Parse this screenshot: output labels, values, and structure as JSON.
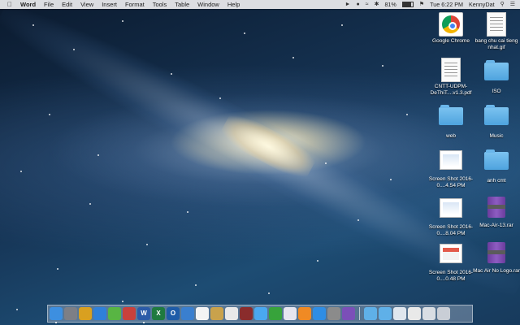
{
  "menubar": {
    "app_name": "Word",
    "menus": [
      "File",
      "Edit",
      "View",
      "Insert",
      "Format",
      "Tools",
      "Table",
      "Window",
      "Help"
    ],
    "battery_percent": "81%",
    "clock": "Tue 6:22 PM",
    "user": "KennyDat"
  },
  "desktop_icons": [
    {
      "label": "Google Chrome"
    },
    {
      "label": "bang chu cai tieng nhat.gif"
    },
    {
      "label": "CNTT-UDPM-DeThiT....v1.3.pdf"
    },
    {
      "label": "ISO"
    },
    {
      "label": "web"
    },
    {
      "label": "Music"
    },
    {
      "label": "Screen Shot 2016-0....4.54 PM"
    },
    {
      "label": "anh cmt"
    },
    {
      "label": "Screen Shot 2016-0....8.04 PM"
    },
    {
      "label": "Mac-Air-13.rar"
    },
    {
      "label": "Screen Shot 2016-0....0.48 PM"
    },
    {
      "label": "Mac Air No Logo.rar"
    }
  ],
  "dock": {
    "apps": [
      {
        "name": "finder-icon",
        "color": "#3d8fe0"
      },
      {
        "name": "launchpad-icon",
        "color": "#7d7f86"
      },
      {
        "name": "app-icon-yellow",
        "color": "#d9a020"
      },
      {
        "name": "safari-icon",
        "color": "#2f80d9"
      },
      {
        "name": "app-icon-green",
        "color": "#58b543"
      },
      {
        "name": "app-icon-red",
        "color": "#c9413c"
      },
      {
        "name": "word-icon",
        "color": "#2b5ba8",
        "glyph": "W"
      },
      {
        "name": "excel-icon",
        "color": "#1f7a3f",
        "glyph": "X"
      },
      {
        "name": "outlook-icon",
        "color": "#1f5ca8",
        "glyph": "O"
      },
      {
        "name": "app-icon-blue",
        "color": "#3a7fcf"
      },
      {
        "name": "calendar-icon",
        "color": "#f4f4f4"
      },
      {
        "name": "notes-icon",
        "color": "#c9a24c"
      },
      {
        "name": "photos-icon",
        "color": "#e9e9e9"
      },
      {
        "name": "photo-booth-icon",
        "color": "#8a2c2c"
      },
      {
        "name": "messages-icon",
        "color": "#4aa8f0"
      },
      {
        "name": "facetime-icon",
        "color": "#37a33b"
      },
      {
        "name": "itunes-icon",
        "color": "#e6e6f0"
      },
      {
        "name": "ibooks-icon",
        "color": "#f08a24"
      },
      {
        "name": "app-store-icon",
        "color": "#2f8de4"
      },
      {
        "name": "system-preferences-icon",
        "color": "#8b8b8b"
      },
      {
        "name": "app-icon-purple",
        "color": "#7b4fb8"
      }
    ],
    "stacks": [
      {
        "name": "folder-stack-icon",
        "color": "#5fb0e8"
      },
      {
        "name": "downloads-stack-icon",
        "color": "#5fb0e8"
      },
      {
        "name": "screenshot-stack-icon",
        "color": "#dfe6ee"
      },
      {
        "name": "document-stack-icon",
        "color": "#e9e9e9"
      },
      {
        "name": "image-stack-icon",
        "color": "#d8dde3"
      },
      {
        "name": "trash-icon",
        "color": "#c9ced6"
      }
    ]
  }
}
